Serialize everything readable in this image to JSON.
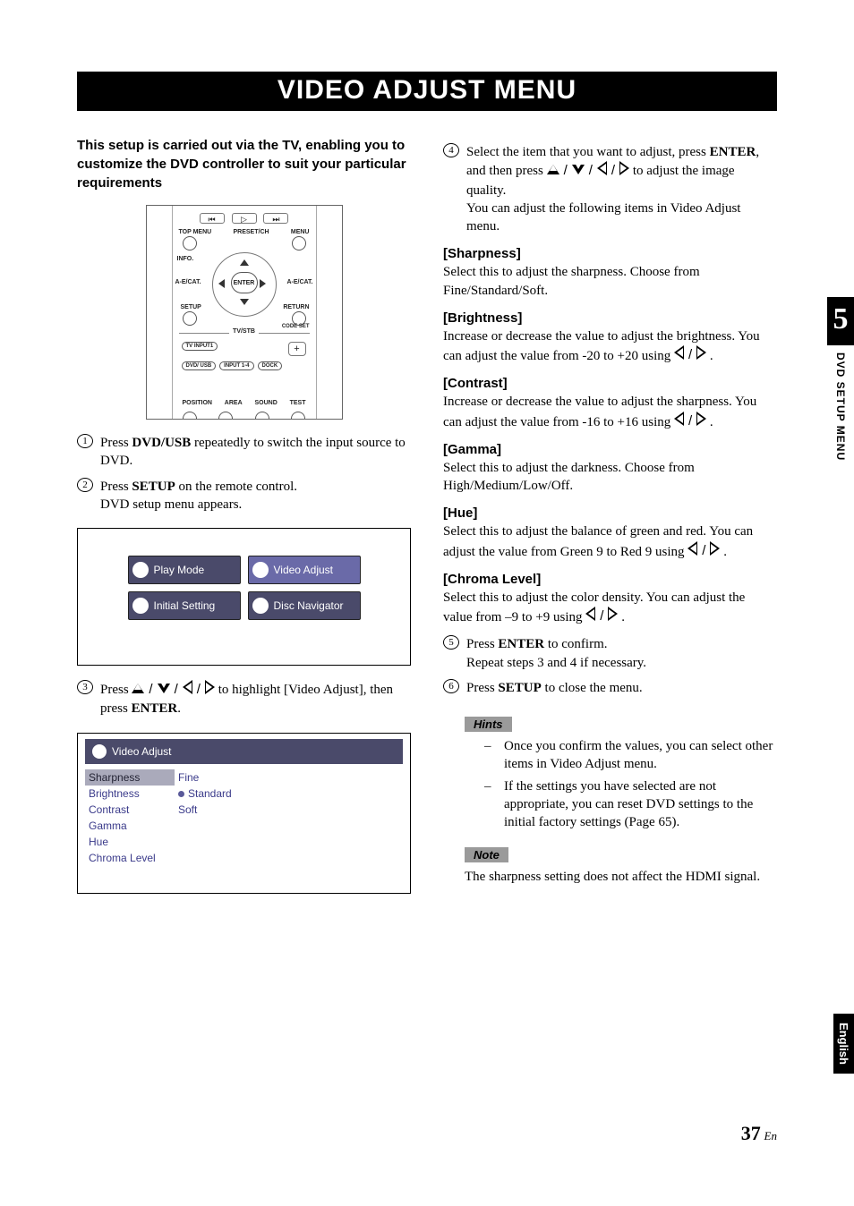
{
  "title": "VIDEO ADJUST MENU",
  "intro": "This setup is carried out via the TV, enabling you to customize the DVD controller to suit your particular requirements",
  "remote": {
    "top_menu": "TOP MENU",
    "preset_ch": "PRESET/CH",
    "menu": "MENU",
    "info": "INFO.",
    "enter": "ENTER",
    "aecat_l": "A-E/CAT.",
    "aecat_r": "A-E/CAT.",
    "setup": "SETUP",
    "return": "RETURN",
    "codeset": "CODE SET",
    "tvstb": "TV/STB",
    "tvinput1": "TV INPUT1",
    "dvdusb": "DVD/ USB",
    "input14": "INPUT 1-4",
    "dock": "DOCK",
    "position": "POSITION",
    "area": "AREA",
    "sound": "SOUND",
    "test": "TEST",
    "prev": "⏮",
    "play": "▷",
    "next": "⏭"
  },
  "steps_left": {
    "s1a": "Press ",
    "s1b": "DVD/USB",
    "s1c": " repeatedly to switch the input source to DVD.",
    "s2a": "Press ",
    "s2b": "SETUP",
    "s2c": " on the remote control.",
    "s2d": "DVD setup menu appears.",
    "s3a": "Press ",
    "s3b": " to highlight [Video Adjust], then press ",
    "s3c": "ENTER",
    "s3d": "."
  },
  "menu": {
    "play_mode": "Play Mode",
    "video_adjust": "Video Adjust",
    "initial_setting": "Initial Setting",
    "disc_navigator": "Disc Navigator"
  },
  "va_panel": {
    "title": "Video Adjust",
    "rows": {
      "sharpness": "Sharpness",
      "brightness": "Brightness",
      "contrast": "Contrast",
      "gamma": "Gamma",
      "hue": "Hue",
      "chroma": "Chroma Level"
    },
    "vals": {
      "fine": "Fine",
      "standard": "Standard",
      "soft": "Soft"
    }
  },
  "right": {
    "s4a": "Select the item that you want to adjust, press ",
    "s4b": "ENTER",
    "s4c": ", and then press ",
    "s4d": " to adjust the image quality.",
    "s4e": "You can adjust the following items in Video Adjust menu.",
    "sharp_h": "[Sharpness]",
    "sharp_b": "Select this to adjust the sharpness. Choose from Fine/Standard/Soft.",
    "bright_h": "[Brightness]",
    "bright_b1": "Increase or decrease the value to adjust the brightness. You can adjust the value from -20 to +20 using ",
    "bright_b2": ".",
    "contrast_h": "[Contrast]",
    "contrast_b1": "Increase or decrease the value to adjust the sharpness. You can adjust the value from -16 to +16 using ",
    "contrast_b2": ".",
    "gamma_h": "[Gamma]",
    "gamma_b": "Select this to adjust the darkness. Choose from High/Medium/Low/Off.",
    "hue_h": "[Hue]",
    "hue_b1": "Select this to adjust the balance of green and red. You can adjust the value from Green 9 to Red 9 using ",
    "hue_b2": ".",
    "chroma_h": "[Chroma Level]",
    "chroma_b1": "Select this to adjust the color density. You can adjust the value from –9 to +9 using ",
    "chroma_b2": ".",
    "s5a": "Press ",
    "s5b": "ENTER",
    "s5c": " to confirm.",
    "s5d": "Repeat steps 3 and 4 if necessary.",
    "s6a": "Press ",
    "s6b": "SETUP",
    "s6c": " to close the menu.",
    "hints_tag": "Hints",
    "hint1": "Once you confirm the values, you can select other items in Video Adjust menu.",
    "hint2": "If the settings you have selected are not appropriate, you can reset DVD settings to the initial factory settings (Page 65).",
    "note_tag": "Note",
    "note_b": "The sharpness setting does not affect the HDMI signal."
  },
  "side": {
    "chapter_num": "5",
    "chapter_label": "DVD SETUP MENU",
    "language": "English"
  },
  "page": {
    "num": "37",
    "suffix": "En"
  }
}
